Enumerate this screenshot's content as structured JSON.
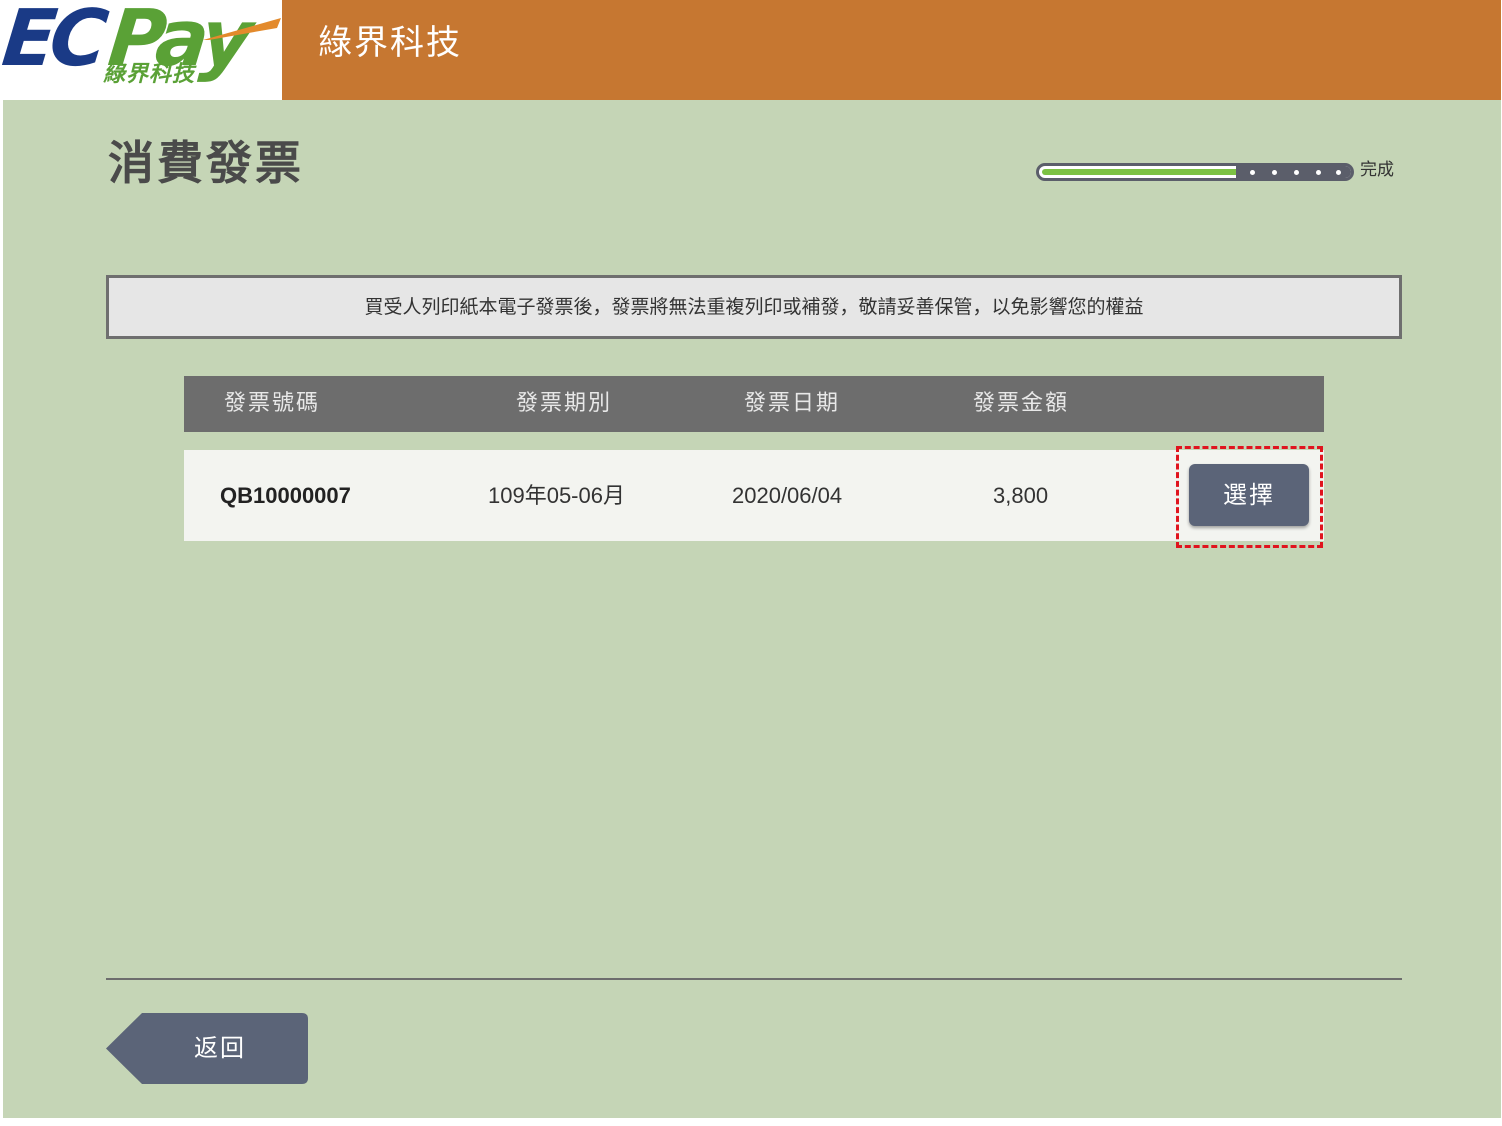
{
  "header": {
    "logo_main_left": "EC",
    "logo_main_right": "Pay",
    "logo_sub": "綠界科技",
    "title": "綠界科技"
  },
  "page": {
    "title": "消費發票"
  },
  "progress": {
    "label": "完成",
    "fraction": 0.65
  },
  "notice": {
    "text": "買受人列印紙本電子發票後，發票將無法重複列印或補發，敬請妥善保管，以免影響您的權益"
  },
  "table": {
    "headers": [
      "發票號碼",
      "發票期別",
      "發票日期",
      "發票金額"
    ],
    "rows": [
      {
        "invoice_number": "QB10000007",
        "period": "109年05-06月",
        "date": "2020/06/04",
        "amount": "3,800",
        "action_label": "選擇"
      }
    ]
  },
  "footer": {
    "back_label": "返回"
  },
  "colors": {
    "header_bg": "#c67731",
    "page_bg": "#c5d5b6",
    "table_header_bg": "#6d6d6d",
    "button_bg": "#5b6478",
    "highlight": "#e0141e",
    "progress_fill": "#7cc243"
  }
}
